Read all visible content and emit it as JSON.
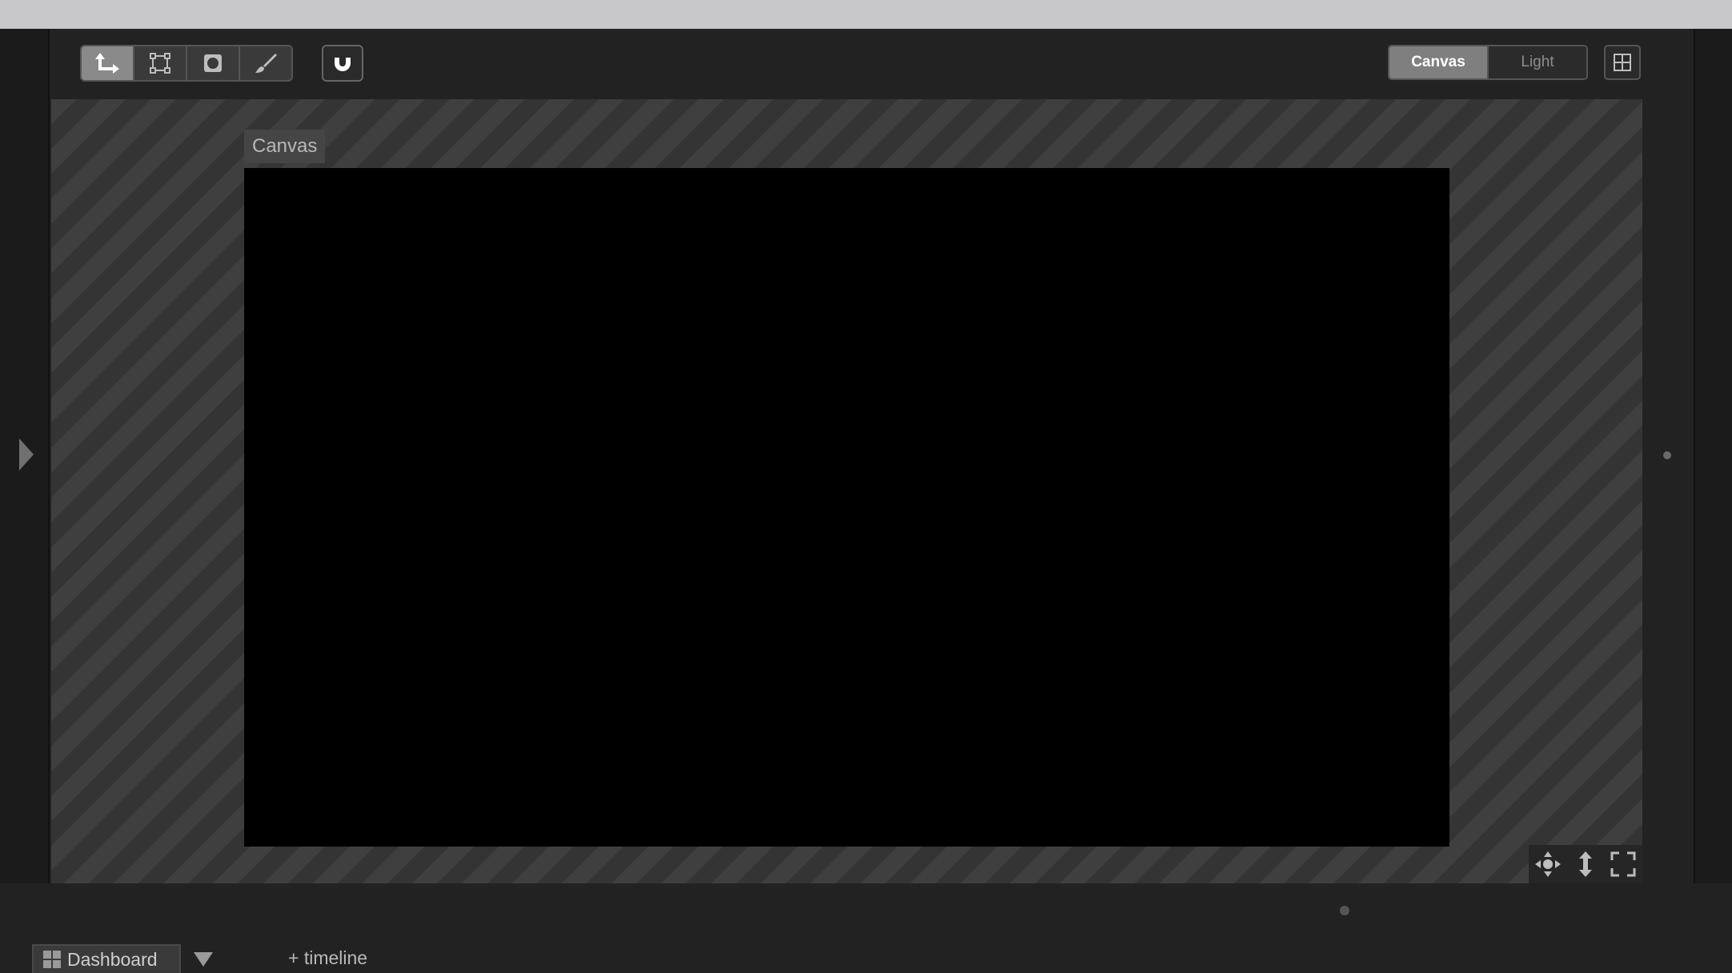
{
  "toolbar": {
    "tools": [
      {
        "name": "move-tool",
        "icon": "move-arrow-icon",
        "active": true
      },
      {
        "name": "transform-tool",
        "icon": "transform-box-icon",
        "active": false
      },
      {
        "name": "mask-tool",
        "icon": "mask-circle-icon",
        "active": false
      },
      {
        "name": "brush-tool",
        "icon": "brush-icon",
        "active": false
      }
    ],
    "snap_icon": "magnet-icon",
    "view_modes": [
      "Canvas",
      "Light"
    ],
    "active_view_mode": "Canvas",
    "layout_icon": "grid-layout-icon"
  },
  "stage": {
    "canvas_label": "Canvas"
  },
  "view_controls": [
    "pan-icon",
    "vertical-resize-icon",
    "fullscreen-icon"
  ],
  "bottom_bar": {
    "tab_label": "Dashboard",
    "add_timeline_label": "+ timeline"
  },
  "colors": {
    "background": "#222222",
    "canvas": "#000000",
    "active_segment": "#7f7f7f",
    "titlebar": "#c8c8ca"
  }
}
